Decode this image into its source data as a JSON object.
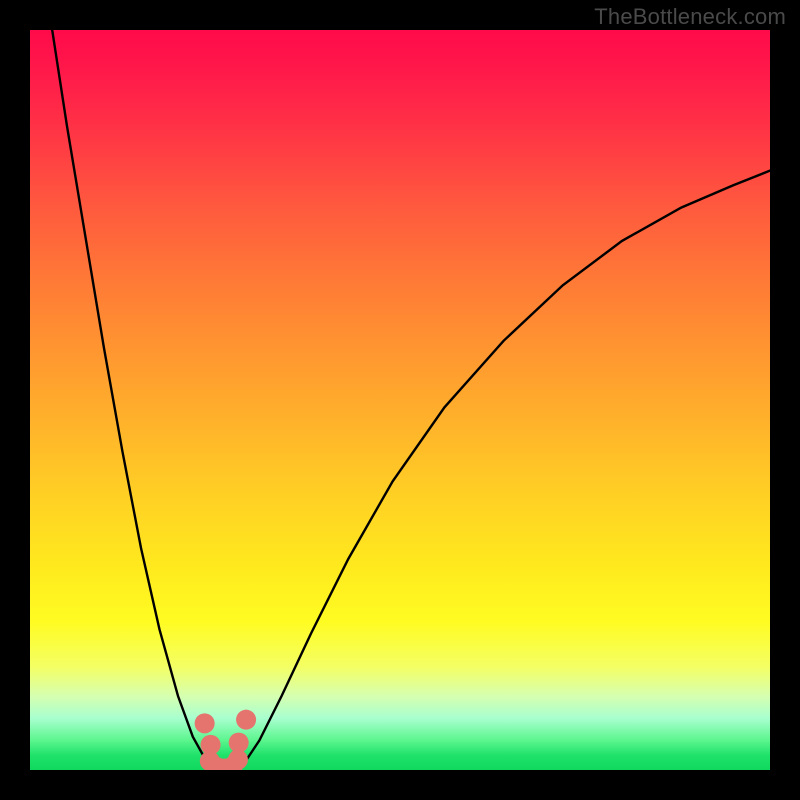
{
  "watermark": "TheBottleneck.com",
  "colors": {
    "frame": "#000000",
    "curve": "#000000",
    "marker_fill": "#e5736e",
    "marker_stroke": "#d95b55",
    "gradient_top": "#ff0a4a",
    "gradient_bottom": "#10d85f"
  },
  "chart_data": {
    "type": "line",
    "title": "",
    "xlabel": "",
    "ylabel": "",
    "xlim": [
      0,
      100
    ],
    "ylim": [
      0,
      100
    ],
    "grid": false,
    "series": [
      {
        "name": "left-branch",
        "x": [
          3.0,
          5.0,
          7.5,
          10.0,
          12.5,
          15.0,
          17.5,
          20.0,
          22.0,
          23.5,
          24.5,
          25.2,
          25.8
        ],
        "y": [
          100,
          87,
          72,
          57,
          43,
          30,
          19,
          10,
          4.5,
          1.8,
          0.7,
          0.2,
          0.0
        ]
      },
      {
        "name": "right-branch",
        "x": [
          28.0,
          29.2,
          31.0,
          34.0,
          38.0,
          43.0,
          49.0,
          56.0,
          64.0,
          72.0,
          80.0,
          88.0,
          95.0,
          100.0
        ],
        "y": [
          0.0,
          1.3,
          4.0,
          10.0,
          18.5,
          28.5,
          39.0,
          49.0,
          58.0,
          65.5,
          71.5,
          76.0,
          79.0,
          81.0
        ]
      }
    ],
    "markers": {
      "name": "bottom-cluster",
      "points": [
        {
          "x": 23.6,
          "y": 6.3
        },
        {
          "x": 24.4,
          "y": 3.4
        },
        {
          "x": 24.3,
          "y": 1.2
        },
        {
          "x": 25.2,
          "y": 0.4
        },
        {
          "x": 26.3,
          "y": 0.2
        },
        {
          "x": 27.4,
          "y": 0.5
        },
        {
          "x": 28.1,
          "y": 1.4
        },
        {
          "x": 28.2,
          "y": 3.7
        },
        {
          "x": 29.2,
          "y": 6.8
        }
      ],
      "radius": 10
    }
  }
}
